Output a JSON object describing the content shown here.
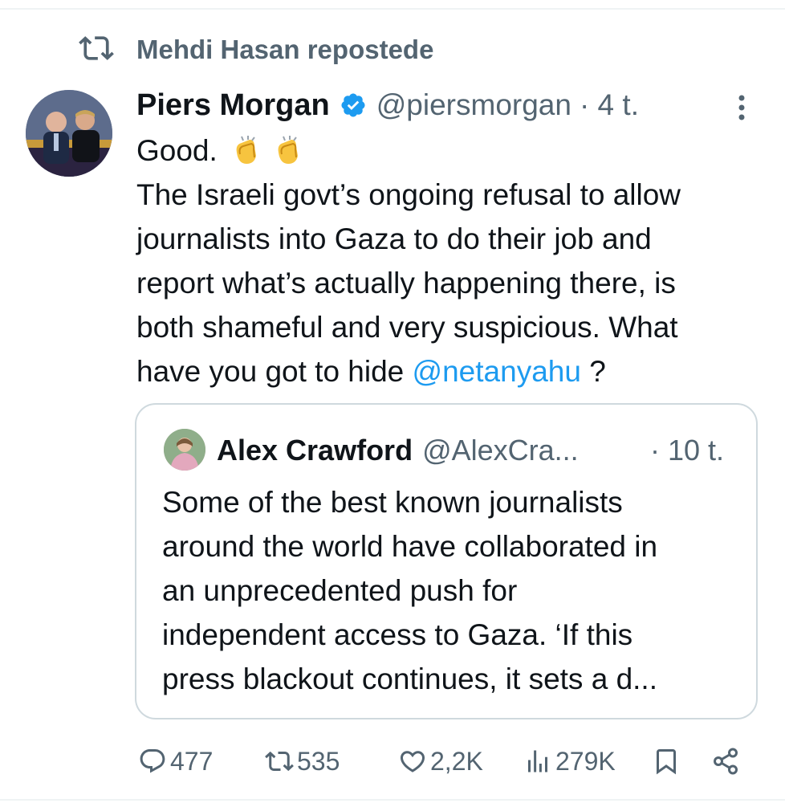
{
  "repost": {
    "text": "Mehdi Hasan repostede",
    "icon": "repost-icon"
  },
  "tweet": {
    "author_name": "Piers Morgan",
    "handle": "@piersmorgan",
    "time": "· 4 t.",
    "verified_color": "#1d9bf0",
    "line1": "Good.",
    "line2": "The Israeli govt’s ongoing refusal to allow",
    "line3": "journalists into Gaza to do their job and",
    "line4": "report what’s actually happening there, is",
    "line5": "both shameful and very suspicious. What",
    "line6_pre": "have you got to hide ",
    "mention": "@netanyahu",
    "line6_post": " ?"
  },
  "quote": {
    "author_name": "Alex Crawford",
    "handle": "@AlexCra...",
    "time": "· 10 t.",
    "lines": [
      "Some of the best known journalists",
      "around the world have collaborated in",
      "an unprecedented push for",
      "independent access to Gaza. ‘If this",
      "press blackout continues, it sets a d..."
    ]
  },
  "actions": {
    "replies": "477",
    "reposts": "535",
    "likes": "2,2K",
    "views": "279K",
    "icons": [
      "reply-icon",
      "repost-icon",
      "like-icon",
      "views-icon",
      "bookmark-icon",
      "share-icon"
    ]
  }
}
